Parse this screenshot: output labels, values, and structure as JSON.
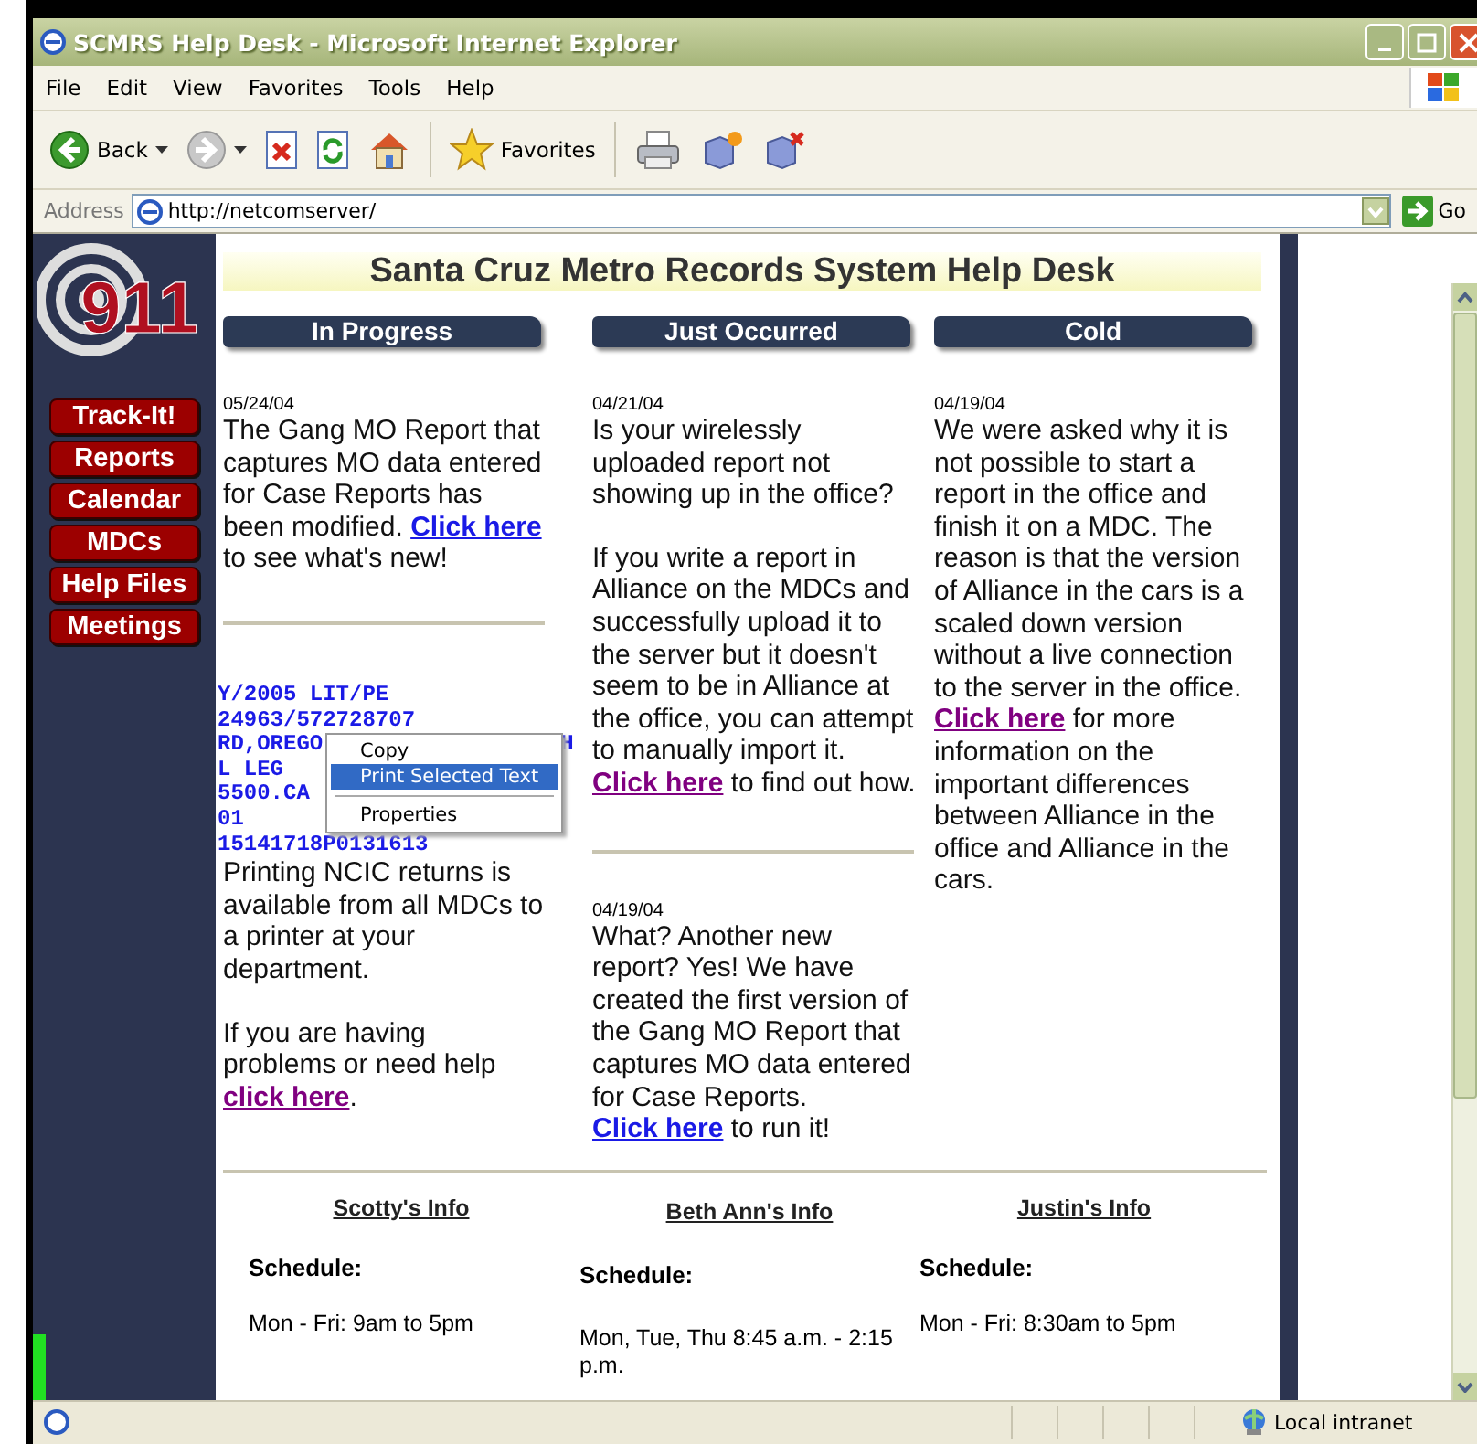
{
  "window": {
    "title": "SCMRS Help Desk - Microsoft Internet Explorer"
  },
  "menu": [
    "File",
    "Edit",
    "View",
    "Favorites",
    "Tools",
    "Help"
  ],
  "toolbar": [
    {
      "kind": "back",
      "label": "Back"
    },
    {
      "kind": "forward"
    },
    {
      "kind": "stop"
    },
    {
      "kind": "refresh"
    },
    {
      "kind": "home"
    },
    {
      "kind": "favorites",
      "label": "Favorites"
    },
    {
      "kind": "print"
    },
    {
      "kind": "new"
    },
    {
      "kind": "delete"
    }
  ],
  "address": {
    "label": "Address",
    "value": "http://netcomserver/",
    "go": "Go"
  },
  "sidebar": {
    "logo": "911",
    "nav": [
      "Track-It!",
      "Reports",
      "Calendar",
      "MDCs",
      "Help Files",
      "Meetings"
    ]
  },
  "page": {
    "title": "Santa Cruz Metro Records System Help Desk",
    "columns": [
      {
        "heading": "In Progress",
        "entries": [
          {
            "kind": "post",
            "date": "05/24/04",
            "paragraphs": [
              [
                {
                  "text": "The Gang MO Report that captures MO data entered for Case Reports has been modified. "
                },
                {
                  "link": "Click here",
                  "visited": false
                },
                {
                  "text": " to see what's new!"
                }
              ]
            ]
          },
          {
            "kind": "divider"
          },
          {
            "kind": "ncic",
            "lines": [
              [
                "Y/2005 LIT/PE"
              ],
              [
                "24963/572728707"
              ],
              [
                "RD,OREGO",
                "H"
              ],
              [
                "L LEG"
              ],
              [
                "5500.CA"
              ],
              [
                "01"
              ],
              [
                "15141718P0131613"
              ]
            ]
          },
          {
            "kind": "post",
            "paragraphs": [
              [
                {
                  "text": "Printing NCIC returns is available from all MDCs to a printer at your department."
                }
              ],
              [
                {
                  "text": "If you are having problems or need help "
                },
                {
                  "link": "click here",
                  "visited": true
                },
                {
                  "text": "."
                }
              ]
            ]
          }
        ]
      },
      {
        "heading": "Just Occurred",
        "entries": [
          {
            "kind": "post",
            "date": "04/21/04",
            "paragraphs": [
              [
                {
                  "text": "Is your wirelessly uploaded report not showing up in the office?"
                }
              ],
              [
                {
                  "text": "If you write a report in Alliance on the MDCs and successfully upload it to the server but it doesn't seem to be in Alliance at the office, you can attempt to manually import it. "
                },
                {
                  "link": "Click here",
                  "visited": true
                },
                {
                  "text": " to find out how."
                }
              ]
            ]
          },
          {
            "kind": "divider"
          },
          {
            "kind": "post",
            "date": "04/19/04",
            "paragraphs": [
              [
                {
                  "text": "What? Another new report? Yes! We have created the first version of the Gang MO Report that captures MO data entered for Case Reports. "
                },
                {
                  "link": "Click here",
                  "visited": false
                },
                {
                  "text": " to run it!"
                }
              ]
            ]
          }
        ]
      },
      {
        "heading": "Cold",
        "entries": [
          {
            "kind": "post",
            "date": "04/19/04",
            "paragraphs": [
              [
                {
                  "text": "We were asked why it is not possible to start a report in the office and finish it on a MDC. The reason is that the version of Alliance in the cars is a scaled down version without a live connection to the server in the office. "
                },
                {
                  "link": "Click here",
                  "visited": true
                },
                {
                  "text": " for more information on the important differences between Alliance in the office and Alliance in the cars."
                }
              ]
            ]
          }
        ]
      }
    ],
    "staff": [
      {
        "name": "Scotty's Info",
        "schedule_label": "Schedule:",
        "hours": "Mon - Fri: 9am to 5pm"
      },
      {
        "name": "Beth Ann's Info",
        "schedule_label": "Schedule:",
        "hours": "Mon, Tue, Thu 8:45 a.m. - 2:15 p.m."
      },
      {
        "name": "Justin's Info",
        "schedule_label": "Schedule:",
        "hours": "Mon - Fri: 8:30am to 5pm"
      }
    ]
  },
  "context_menu": [
    {
      "kind": "item",
      "label": "Copy",
      "selected": false
    },
    {
      "kind": "item",
      "label": "Print Selected Text",
      "selected": true
    },
    {
      "kind": "separator"
    },
    {
      "kind": "item",
      "label": "Properties",
      "selected": false
    }
  ],
  "status_bar": {
    "zone": "Local intranet"
  }
}
